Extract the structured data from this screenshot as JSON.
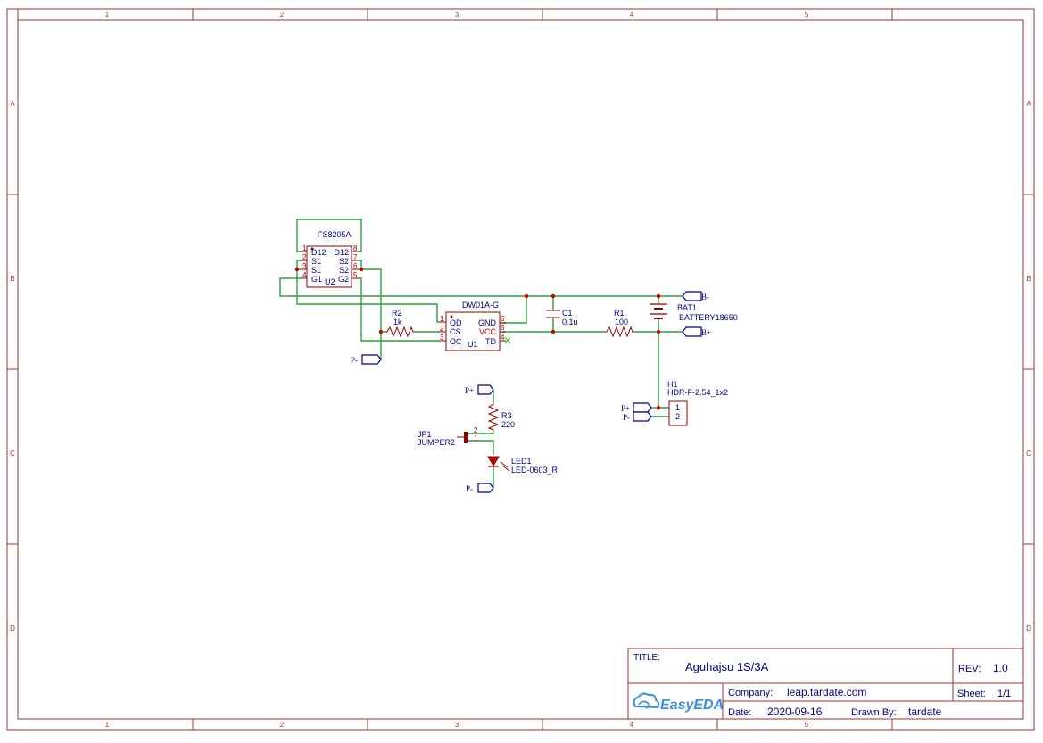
{
  "frame": {
    "columns": [
      "1",
      "2",
      "3",
      "4",
      "5"
    ],
    "rows": [
      "A",
      "B",
      "C",
      "D"
    ]
  },
  "title_block": {
    "title_label": "TITLE:",
    "title": "Aguhajsu 1S/3A",
    "rev_label": "REV:",
    "rev": "1.0",
    "company_label": "Company:",
    "company": "leap.tardate.com",
    "sheet_label": "Sheet:",
    "sheet": "1/1",
    "date_label": "Date:",
    "date": "2020-09-16",
    "drawn_label": "Drawn By:",
    "drawn_by": "tardate",
    "logo_text": "EasyEDA"
  },
  "components": {
    "u2": {
      "name": "FS8205A",
      "ref": "U2",
      "pins_left": [
        {
          "num": "1",
          "name": "D12"
        },
        {
          "num": "2",
          "name": "S1"
        },
        {
          "num": "3",
          "name": "S1"
        },
        {
          "num": "4",
          "name": "G1"
        }
      ],
      "pins_right": [
        {
          "num": "8",
          "name": "D12"
        },
        {
          "num": "7",
          "name": "S2"
        },
        {
          "num": "6",
          "name": "S2"
        },
        {
          "num": "5",
          "name": "G2"
        }
      ]
    },
    "u1": {
      "name": "DW01A-G",
      "ref": "U1",
      "pins_left": [
        {
          "num": "1",
          "name": "OD"
        },
        {
          "num": "2",
          "name": "CS"
        },
        {
          "num": "3",
          "name": "OC"
        }
      ],
      "pins_right": [
        {
          "num": "6",
          "name": "GND"
        },
        {
          "num": "5",
          "name": "VCC"
        },
        {
          "num": "4",
          "name": "TD"
        }
      ]
    },
    "r2": {
      "ref": "R2",
      "value": "1k"
    },
    "c1": {
      "ref": "C1",
      "value": "0.1u"
    },
    "r1": {
      "ref": "R1",
      "value": "100"
    },
    "bat1": {
      "ref": "BAT1",
      "value": "BATTERY18650"
    },
    "h1": {
      "ref": "H1",
      "value": "HDR-F-2.54_1x2",
      "pin1": "1",
      "pin2": "2"
    },
    "r3": {
      "ref": "R3",
      "value": "220"
    },
    "jp1": {
      "ref": "JP1",
      "value": "JUMPER2",
      "pin1": "1",
      "pin2": "2"
    },
    "led1": {
      "ref": "LED1",
      "value": "LED-0603_R"
    }
  },
  "nets": {
    "b_minus": "B-",
    "b_plus": "B+",
    "p_minus": "P-",
    "p_plus": "P+"
  }
}
